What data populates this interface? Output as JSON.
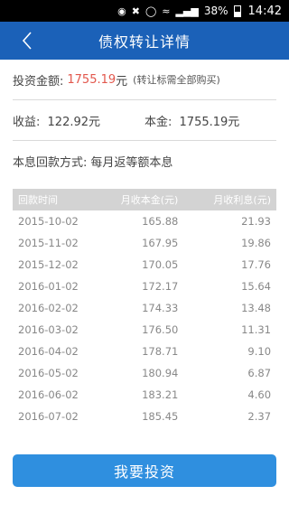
{
  "status_bar": {
    "battery": "38%",
    "time": "14:42"
  },
  "header": {
    "title": "债权转让详情"
  },
  "summary": {
    "invest_label": "投资金额:",
    "invest_value": "1755.19",
    "invest_unit": "元",
    "invest_note": "(转让标需全部购买)",
    "income_label": "收益:",
    "income_value": "122.92元",
    "principal_label": "本金:",
    "principal_value": "1755.19元",
    "repay_label": "本息回款方式:",
    "repay_value": "每月返等额本息"
  },
  "table": {
    "headers": [
      "回款时间",
      "月收本金(元)",
      "月收利息(元)"
    ],
    "rows": [
      [
        "2015-10-02",
        "165.88",
        "21.93"
      ],
      [
        "2015-11-02",
        "167.95",
        "19.86"
      ],
      [
        "2015-12-02",
        "170.05",
        "17.76"
      ],
      [
        "2016-01-02",
        "172.17",
        "15.64"
      ],
      [
        "2016-02-02",
        "174.33",
        "13.48"
      ],
      [
        "2016-03-02",
        "176.50",
        "11.31"
      ],
      [
        "2016-04-02",
        "178.71",
        "9.10"
      ],
      [
        "2016-05-02",
        "180.94",
        "6.87"
      ],
      [
        "2016-06-02",
        "183.21",
        "4.60"
      ],
      [
        "2016-07-02",
        "185.45",
        "2.37"
      ]
    ]
  },
  "action": {
    "invest_button": "我要投资"
  },
  "colors": {
    "nav": "#1b61b8",
    "button": "#2f8fdf",
    "accent": "#e2574c"
  }
}
